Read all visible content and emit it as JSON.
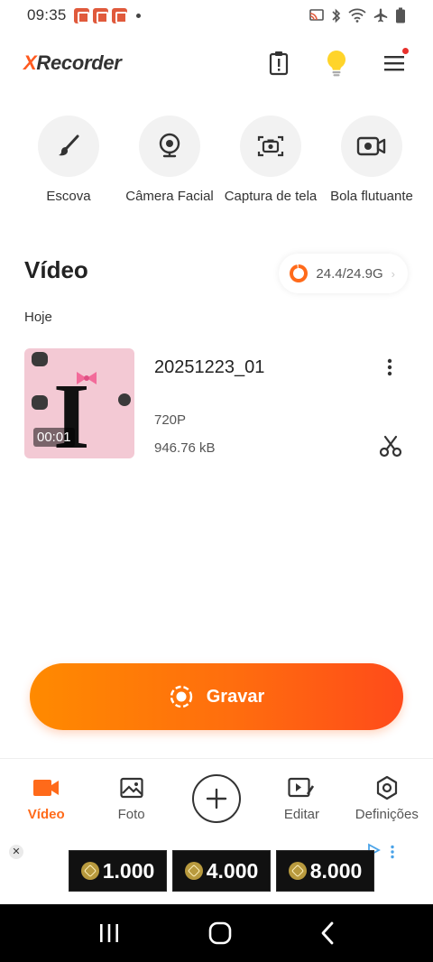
{
  "status_bar": {
    "time": "09:35",
    "notification_icons": [
      "app-notification-icon",
      "app-notification-icon",
      "app-notification-icon"
    ],
    "system_icons": [
      "cast-icon",
      "bluetooth-icon",
      "wifi-icon",
      "airplane-icon",
      "battery-icon"
    ]
  },
  "header": {
    "logo_prefix": "X",
    "logo_rest": "Recorder",
    "actions": [
      "clipboard-alert-icon",
      "lightbulb-icon",
      "hamburger-menu-icon"
    ]
  },
  "tools": [
    {
      "label": "Escova",
      "icon": "brush-icon"
    },
    {
      "label": "Câmera Facial",
      "icon": "webcam-icon"
    },
    {
      "label": "Captura de tela",
      "icon": "screenshot-camera-icon"
    },
    {
      "label": "Bola flutuante",
      "icon": "floating-ball-icon"
    }
  ],
  "video_section": {
    "title": "Vídeo",
    "storage_text": "24.4/24.9G",
    "storage_used_fraction": 0.98,
    "date_group": "Hoje"
  },
  "recordings": [
    {
      "name": "20251223_01",
      "duration": "00:01",
      "resolution": "720P",
      "size": "946.76 kB",
      "thumbnail_char": "I"
    }
  ],
  "record_button": {
    "label": "Gravar"
  },
  "bottom_nav": [
    {
      "label": "Vídeo",
      "icon": "video-camera-icon",
      "active": true
    },
    {
      "label": "Foto",
      "icon": "image-icon",
      "active": false
    },
    {
      "label": "",
      "icon": "plus-icon",
      "active": false
    },
    {
      "label": "Editar",
      "icon": "edit-video-icon",
      "active": false
    },
    {
      "label": "Definições",
      "icon": "settings-hexagon-icon",
      "active": false
    }
  ],
  "ad": {
    "close_glyph": "✕",
    "tiles": [
      "1.000",
      "4.000",
      "8.000"
    ]
  },
  "colors": {
    "accent": "#ff6a1a",
    "record_gradient_start": "#ff8a00",
    "record_gradient_end": "#ff4b1a",
    "thumbnail_bg": "#f3c9d4"
  }
}
